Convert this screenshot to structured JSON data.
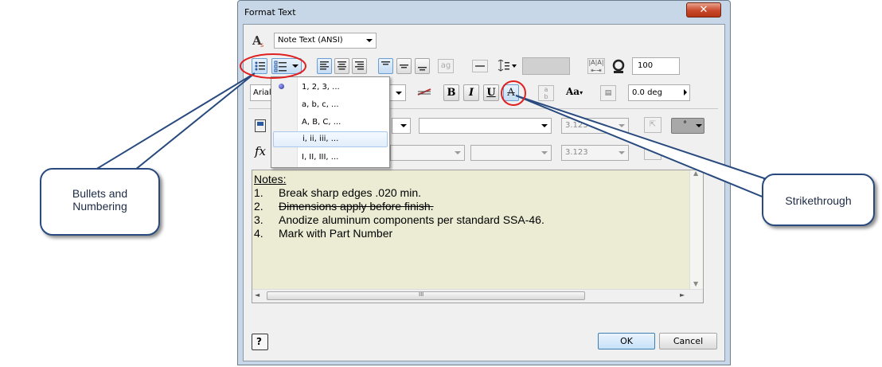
{
  "dialog": {
    "title": "Format Text",
    "close_label": "✕",
    "style_select": "Note Text (ANSI)",
    "font_select": "Arial",
    "color_value": "100",
    "rotation_value": "0.0 deg",
    "precision_1": "3.123",
    "precision_2": "3.123",
    "precision_3": "3.123",
    "fx_label": "fx",
    "ok_label": "OK",
    "cancel_label": "Cancel",
    "help_label": "?"
  },
  "format_buttons": {
    "bold": "B",
    "italic": "I",
    "underline": "U",
    "strikethrough": "A"
  },
  "numbering_menu": {
    "items": [
      "1, 2, 3, ...",
      "a, b, c, ...",
      "A, B, C, ...",
      "i, ii, iii, ...",
      "I, II, III, ..."
    ],
    "selected_index": 3
  },
  "notes": {
    "heading": "Notes:",
    "items": [
      {
        "num": "1.",
        "text": "Break sharp edges .020 min."
      },
      {
        "num": "2.",
        "text": "Dimensions apply before finish."
      },
      {
        "num": "3.",
        "text": "Anodize aluminum components per standard SSA-46."
      },
      {
        "num": "4.",
        "text": "Mark with Part Number"
      }
    ]
  },
  "scrollbar": {
    "grip": "III"
  },
  "callouts": {
    "bullets": "Bullets and Numbering",
    "strike": "Strikethrough"
  },
  "colors": {
    "accent": "#284a7e",
    "highlight_red": "#e02020",
    "editor_bg": "#ececd5"
  }
}
